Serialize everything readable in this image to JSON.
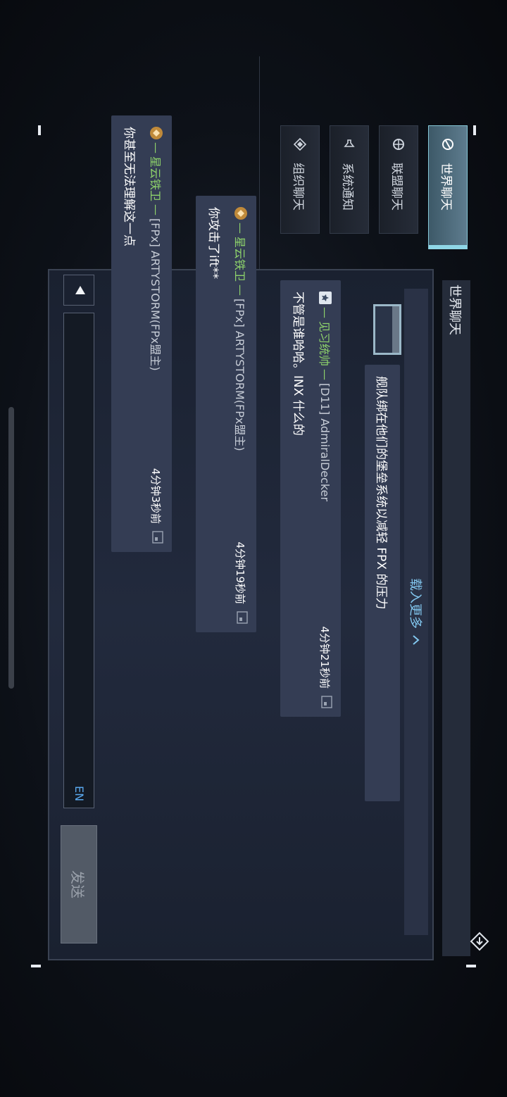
{
  "tabs": [
    {
      "label": "世界聊天",
      "icon": "globe-chat-icon",
      "active": true
    },
    {
      "label": "联盟聊天",
      "icon": "alliance-globe-icon",
      "active": false
    },
    {
      "label": "系统通知",
      "icon": "speaker-icon",
      "active": false
    },
    {
      "label": "组织聊天",
      "icon": "organization-icon",
      "active": false
    }
  ],
  "channel": {
    "title": "世界聊天"
  },
  "load_more": {
    "label": "载入更多",
    "icon": "chevron-up-icon"
  },
  "messages": [
    {
      "text": "舰队绑在他们的堡垒系统以减轻 FPX 的压力"
    },
    {
      "rank": "见习统帅",
      "name": "[D11] AdmiralDecker",
      "text": "不管是谁哈哈。INX 什么的",
      "time": "4分钟21秒前"
    },
    {
      "rank": "星云铁卫",
      "name": "[FPx] ARTYSTORM(FPx盟主)",
      "text": "你攻击了ift**",
      "time": "4分钟19秒前"
    },
    {
      "rank": "星云铁卫",
      "name": "[FPx] ARTYSTORM(FPx盟主)",
      "text": "你甚至无法理解这一点",
      "time": "4分钟3秒前"
    }
  ],
  "input": {
    "lang": "EN",
    "placeholder": ""
  },
  "send_button": {
    "label": "发送"
  },
  "colors": {
    "accent": "#8fd6e6",
    "rank_green": "#8ed36b",
    "link_blue": "#82c7ef"
  }
}
